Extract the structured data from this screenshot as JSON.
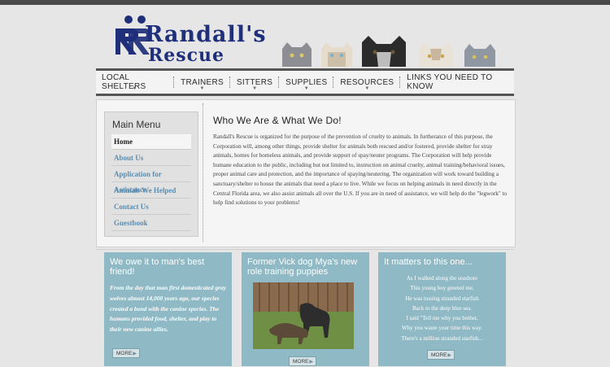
{
  "header": {
    "logo": {
      "line1": "Randall's",
      "line2": "Rescue"
    }
  },
  "nav": {
    "items": [
      {
        "label": "LOCAL SHELTERS",
        "dropdown": true
      },
      {
        "label": "TRAINERS",
        "dropdown": true
      },
      {
        "label": "SITTERS",
        "dropdown": true
      },
      {
        "label": "SUPPLIES",
        "dropdown": true
      },
      {
        "label": "RESOURCES",
        "dropdown": true
      },
      {
        "label": "LINKS YOU NEED TO KNOW",
        "dropdown": false
      }
    ]
  },
  "sidebar": {
    "title": "Main Menu",
    "items": [
      {
        "label": "Home",
        "active": true
      },
      {
        "label": "About Us"
      },
      {
        "label": "Application for Assistance"
      },
      {
        "label": "Animals We Helped"
      },
      {
        "label": "Contact Us"
      },
      {
        "label": "Guestbook"
      }
    ]
  },
  "main": {
    "title": "Who We Are & What We Do!",
    "body": "Randall's Rescue is organized for the purpose of the prevention of cruelty to animals. In furtherance of this purpose, the Corporation will, among other things, provide shelter for animals both rescued and/or fostered, provide shelter for stray animals, homes for homeless animals, and provide support of spay/neuter programs. The Corporation will help provide humane education to the public, including but not limited to, instruction on animal cruelty, animal training/behavioral issues, proper animal care and protection, and the importance of spaying/neutering. The organization will work toward building a sanctuary/shelter to house the animals that need a place to live. While we focus on helping animals in need directly in the Central Florida area, we also assist animals all over the U.S. If you are in need of assistance, we will help do the \"legwork\" to help find solutions to your problems!"
  },
  "cards": [
    {
      "title": "We owe it to man's best friend!",
      "body": "From the day that man first domesticated gray wolves almost 14,000 years ago, our species created a bond with the canine species. The humans provided food, shelter, and play to their new canine allies.",
      "more": "MORE"
    },
    {
      "title": "Former Vick dog Mya's new role training puppies",
      "more": "MORE"
    },
    {
      "title": "It matters to this one...",
      "poem": [
        "As I walked along the seashore",
        "This young boy greeted me.",
        "He was tossing stranded starfish",
        "Back to the deep blue sea.",
        "I said \"Tell me why you bother,",
        "Why you waste your time this way.",
        "There's a million stranded starfish..."
      ],
      "more": "MORE"
    }
  ],
  "colors": {
    "brand_blue": "#1f2f7a",
    "card_bg": "#8fb9c4",
    "link_blue": "#5b8db0"
  }
}
